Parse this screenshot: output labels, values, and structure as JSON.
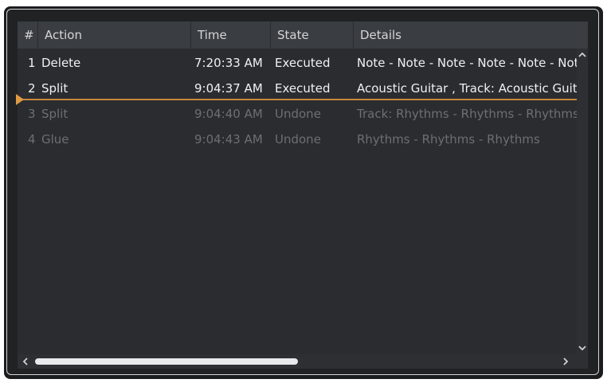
{
  "columns": {
    "num": "#",
    "action": "Action",
    "time": "Time",
    "state": "State",
    "details": "Details"
  },
  "rows": [
    {
      "num": "1",
      "action": "Delete",
      "time": "7:20:33 AM",
      "state": "Executed",
      "details": "Note - Note - Note - Note - Note - Not"
    },
    {
      "num": "2",
      "action": "Split",
      "time": "9:04:37 AM",
      "state": "Executed",
      "details": "Acoustic Guitar , Track: Acoustic Guitar"
    },
    {
      "num": "3",
      "action": "Split",
      "time": "9:04:40 AM",
      "state": "Undone",
      "details": "Track: Rhythms - Rhythms - Rhythms - F"
    },
    {
      "num": "4",
      "action": "Glue",
      "time": "9:04:43 AM",
      "state": "Undone",
      "details": "Rhythms - Rhythms - Rhythms"
    }
  ],
  "scrollbars": {
    "up_icon": "chevron-up-icon",
    "down_icon": "chevron-down-icon",
    "left_icon": "chevron-left-icon",
    "right_icon": "chevron-right-icon"
  },
  "colors": {
    "executed_text": "#f0f1f2",
    "undone_text": "#6c6f73",
    "marker": "#e09a44"
  }
}
